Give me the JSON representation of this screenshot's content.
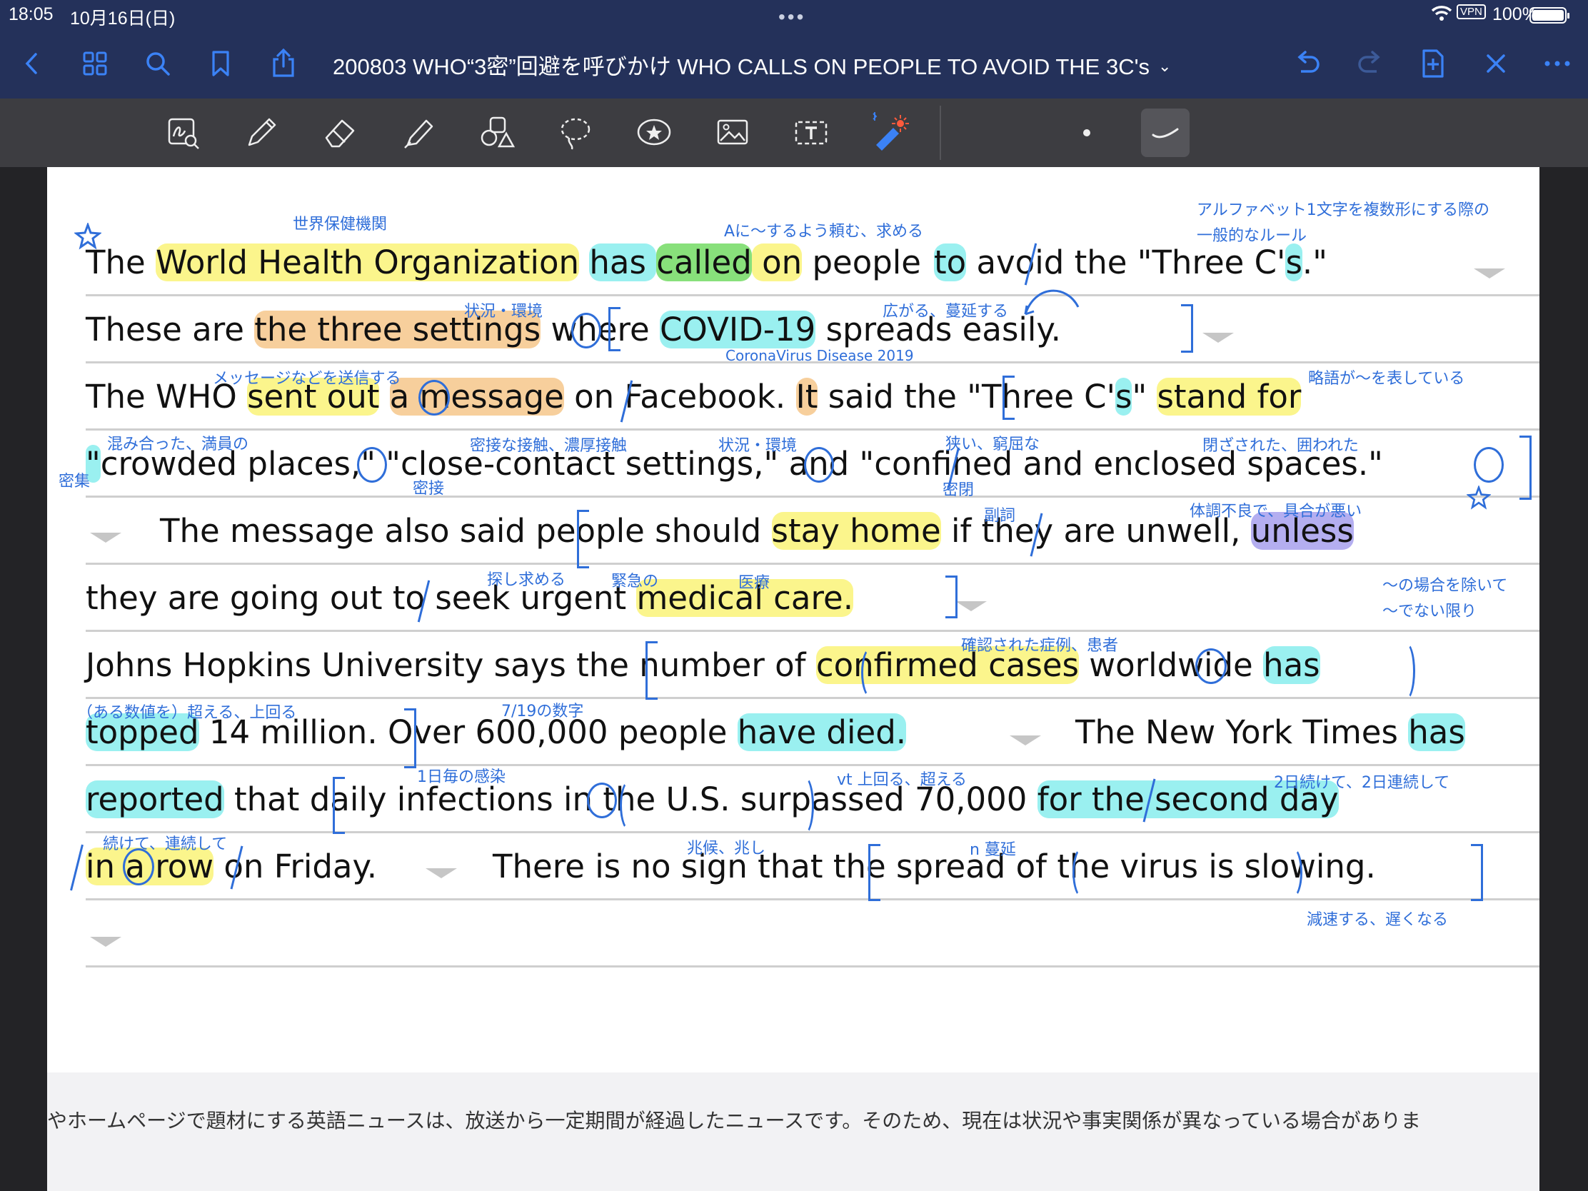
{
  "status": {
    "time": "18:05",
    "date": "10月16日(日)",
    "vpn": "VPN",
    "battery": "100%"
  },
  "nav": {
    "title": "200803 WHO“3密”回避を呼びかけ WHO CALLS ON PEOPLE TO AVOID THE 3C's",
    "title_chevron": "⌄"
  },
  "lines": {
    "l1": {
      "a": "The ",
      "b": "World Health Organization",
      "c": " ",
      "d": "has ",
      "e": "called",
      "f": " on",
      "g": " people",
      "h": "to",
      "i": " avoid the \"Three C'",
      "j": "s",
      "k": ".\""
    },
    "l2": {
      "a": "These are ",
      "b": "the three settings",
      "c": " where ",
      "d": "COVID-19",
      "e": " spreads easily."
    },
    "l3": {
      "a": "The WHO ",
      "b": "sent out",
      "c": " ",
      "d": "a message",
      "e": " on Facebook. ",
      "f": "It",
      "g": " said  the \"Three C'",
      "h": "s",
      "i": "\" ",
      "j": "stand for"
    },
    "l4": {
      "a": "\"",
      "b": "crowded places,\"",
      "c": " \"",
      "d": "close-contact settings,\"",
      "e": " and \"",
      "f": "confined and enclosed spaces",
      "g": ".\""
    },
    "l5": {
      "a": "The message also said  people should ",
      "b": "stay home",
      "c": " if they are unwell, ",
      "d": "unless"
    },
    "l6": {
      "a": "they are going out to seek urgent ",
      "b": "medical care."
    },
    "l7": {
      "a": "Johns Hopkins University says  the number  of ",
      "b": "confirmed cases",
      "c": " worldwide  ",
      "d": "has"
    },
    "l8": {
      "a": "topped",
      "b": " 14 million.  Over 600,000 people ",
      "c": "have died.",
      "d": "The New York Times ",
      "e": "has"
    },
    "l9": {
      "a": "reported",
      "b": " that  daily infections  in the U.S.  surpassed 70,000 ",
      "c": "for the second day"
    },
    "l10": {
      "a": "in a row",
      "b": " on Friday.",
      "c": "There is no sign that  the spread  of the virus  is slowing."
    }
  },
  "annotations": {
    "who": "世界保健機関",
    "call_on": "Aに～するよう頼む、求める",
    "plural_rule_1": "アルファベット1文字を複数形にする際の",
    "plural_rule_2": "一般的なルール",
    "setting": "状況・環境",
    "spread": "広がる、蔓延する",
    "covid": "CoronaVirus Disease 2019",
    "send_out": "メッセージなどを送信する",
    "stand_for": "略語が～を表している",
    "crowded": "混み合った、満員の",
    "mitsu_shu": "密集",
    "close_contact": "密接な接触、濃厚接触",
    "mitsu_setsu": "密接",
    "setting2": "状況・環境",
    "confined": "狭い、窮屈な",
    "mitsu_hei": "密閉",
    "enclosed": "閉ざされた、囲われた",
    "adverb": "副詞",
    "unwell": "体調不良で、具合が悪い",
    "seek": "探し求める",
    "urgent": "緊急の",
    "medical": "医療",
    "unless_1": "～の場合を除いて",
    "unless_2": "～でない限り",
    "confirmed": "確認された症例、患者",
    "top": "（ある数値を）超える、上回る",
    "number_719": "7/19の数字",
    "daily": "1日毎の感染",
    "surpass": "vt 上回る、超える",
    "second_day": "2日続けて、2日連続して",
    "in_a_row": "続けて、連続して",
    "sign": "兆候、兆し",
    "spread_n": "n 蔓延",
    "slow": "減速する、遅くなる"
  },
  "footer": {
    "text": "やホームページで題材にする英語ニュースは、放送から一定期間が経過したニュースです。そのため、現在は状況や事実関係が異なっている場合がありま"
  },
  "icons": [
    "back-icon",
    "grid-icon",
    "search-icon",
    "bookmark-icon",
    "share-icon",
    "undo-icon",
    "redo-icon",
    "add-page-icon",
    "close-icon",
    "more-icon",
    "lasso-zoom-icon",
    "pen-icon",
    "eraser-icon",
    "highlighter-icon",
    "shapes-icon",
    "lasso-icon",
    "sticker-icon",
    "image-icon",
    "textbox-icon",
    "laser-pointer-icon"
  ],
  "colors": {
    "nav_bg": "#24315a",
    "toolbar_bg": "#3d3d41",
    "accent_blue": "#3b82f6",
    "annotation_blue": "#2f6ed9",
    "highlight_yellow": "#fbf58c",
    "highlight_orange": "#f7cf9c",
    "highlight_green": "#88e07b",
    "highlight_cyan": "#9af0f0",
    "highlight_purple": "#b4aef0"
  }
}
